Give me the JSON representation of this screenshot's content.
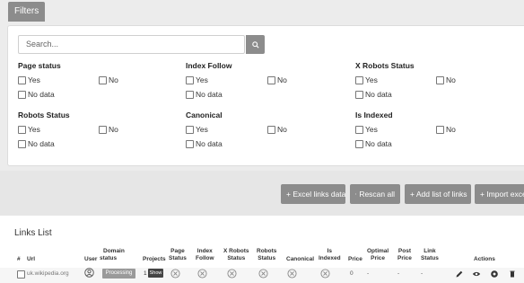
{
  "tabs": {
    "filters": "Filters"
  },
  "search": {
    "placeholder": "Search..."
  },
  "filters": {
    "page_status": {
      "title": "Page status",
      "yes": "Yes",
      "no": "No",
      "nodata": "No data"
    },
    "index_follow": {
      "title": "Index Follow",
      "yes": "Yes",
      "no": "No",
      "nodata": "No data"
    },
    "x_robots": {
      "title": "X Robots Status",
      "yes": "Yes",
      "no": "No",
      "nodata": "No data"
    },
    "robots_status": {
      "title": "Robots Status",
      "yes": "Yes",
      "no": "No",
      "nodata": "No data"
    },
    "canonical": {
      "title": "Canonical",
      "yes": "Yes",
      "no": "No",
      "nodata": "No data"
    },
    "is_indexed": {
      "title": "Is Indexed",
      "yes": "Yes",
      "no": "No",
      "nodata": "No data"
    }
  },
  "buttons": {
    "excel": "+ Excel links data",
    "rescan": "Rescan all",
    "add_list": "+ Add list of links",
    "import": "+ Import exce"
  },
  "links_list": {
    "title": "Links List",
    "headers": {
      "num": "#",
      "url": "Url",
      "user": "User",
      "domain_status_1": "Domain",
      "domain_status_2": "status",
      "projects": "Projects",
      "page_status_1": "Page",
      "page_status_2": "Status",
      "index_follow_1": "Index",
      "index_follow_2": "Follow",
      "x_robots_1": "X Robots",
      "x_robots_2": "Status",
      "robots_1": "Robots",
      "robots_2": "Status",
      "canonical": "Canonical",
      "is_indexed_1": "Is",
      "is_indexed_2": "Indexed",
      "price": "Price",
      "optimal_1": "Optimal",
      "optimal_2": "Price",
      "post_1": "Post",
      "post_2": "Price",
      "link_1": "Link",
      "link_2": "Status",
      "actions": "Actions"
    },
    "rows": [
      {
        "url": "uk.wikipedia.org",
        "domain_status": "Processing",
        "projects_count": "1",
        "projects_show": "Show",
        "price": "0",
        "optimal_price": "-",
        "post_price": "-",
        "link_status": "-"
      }
    ]
  },
  "colors": {
    "button_gray": "#8c8c8c",
    "panel_bg": "#ffffff",
    "page_bg": "#ececec"
  }
}
